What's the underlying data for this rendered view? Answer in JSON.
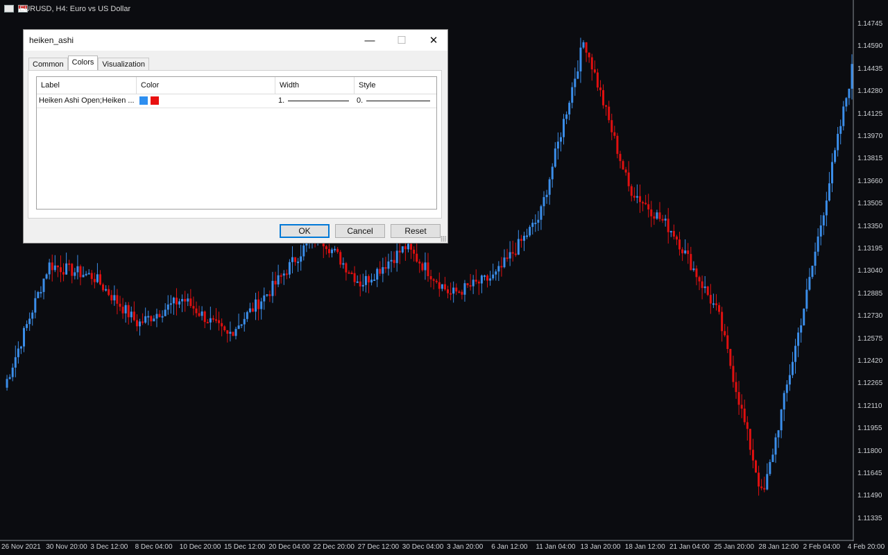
{
  "window_title": "EURUSD, H4:  Euro vs US Dollar",
  "colors": {
    "background": "#0b0c10",
    "bull": "#3b8eea",
    "bear": "#e01010",
    "axis_text": "#cfd2d6"
  },
  "price_axis": [
    "1.14745",
    "1.14590",
    "1.14435",
    "1.14280",
    "1.14125",
    "1.13970",
    "1.13815",
    "1.13660",
    "1.13505",
    "1.13350",
    "1.13195",
    "1.13040",
    "1.12885",
    "1.12730",
    "1.12575",
    "1.12420",
    "1.12265",
    "1.12110",
    "1.11955",
    "1.11800",
    "1.11645",
    "1.11490",
    "1.11335"
  ],
  "date_axis": [
    "26 Nov 2021",
    "30 Nov 20:00",
    "3 Dec 12:00",
    "8 Dec 04:00",
    "10 Dec 20:00",
    "15 Dec 12:00",
    "20 Dec 04:00",
    "22 Dec 20:00",
    "27 Dec 12:00",
    "30 Dec 04:00",
    "3 Jan 20:00",
    "6 Jan 12:00",
    "11 Jan 04:00",
    "13 Jan 20:00",
    "18 Jan 12:00",
    "21 Jan 04:00",
    "25 Jan 20:00",
    "28 Jan 12:00",
    "2 Feb 04:00",
    "4 Feb 20:00"
  ],
  "chart_data": {
    "type": "heiken-ashi candlestick",
    "symbol": "EURUSD",
    "timeframe": "H4",
    "ylim": [
      1.1126,
      1.1482
    ],
    "key_closes": [
      {
        "x": "26 Nov 2021",
        "y": 1.1225
      },
      {
        "x": "30 Nov 20:00",
        "y": 1.1308
      },
      {
        "x": "3 Dec 12:00",
        "y": 1.13
      },
      {
        "x": "8 Dec 04:00",
        "y": 1.1268
      },
      {
        "x": "10 Dec 20:00",
        "y": 1.1285
      },
      {
        "x": "15 Dec 12:00",
        "y": 1.126
      },
      {
        "x": "20 Dec 04:00",
        "y": 1.1292
      },
      {
        "x": "22 Dec 20:00",
        "y": 1.133
      },
      {
        "x": "27 Dec 12:00",
        "y": 1.1295
      },
      {
        "x": "30 Dec 04:00",
        "y": 1.132
      },
      {
        "x": "3 Jan 20:00",
        "y": 1.1288
      },
      {
        "x": "6 Jan 12:00",
        "y": 1.13
      },
      {
        "x": "11 Jan 04:00",
        "y": 1.134
      },
      {
        "x": "13 Jan 20:00",
        "y": 1.146
      },
      {
        "x": "18 Jan 12:00",
        "y": 1.136
      },
      {
        "x": "21 Jan 04:00",
        "y": 1.133
      },
      {
        "x": "25 Jan 20:00",
        "y": 1.1275
      },
      {
        "x": "28 Jan 12:00",
        "y": 1.115
      },
      {
        "x": "2 Feb 04:00",
        "y": 1.129
      },
      {
        "x": "4 Feb 20:00",
        "y": 1.144
      }
    ]
  },
  "dialog": {
    "title": "heiken_ashi",
    "tabs": [
      "Common",
      "Colors",
      "Visualization"
    ],
    "active_tab": "Colors",
    "columns": [
      "Label",
      "Color",
      "Width",
      "Style"
    ],
    "rows": [
      {
        "label": "Heiken Ashi Open;Heiken ...",
        "colors": [
          "#2e8ff0",
          "#e81010"
        ],
        "width": "1.",
        "style": "0."
      }
    ],
    "buttons": {
      "ok": "OK",
      "cancel": "Cancel",
      "reset": "Reset"
    }
  }
}
